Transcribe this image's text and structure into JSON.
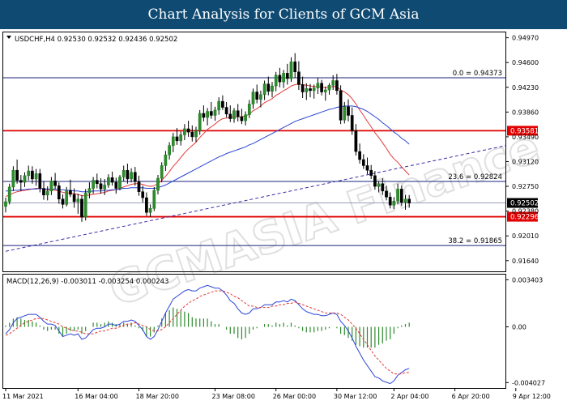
{
  "header": {
    "title": "Chart Analysis for Clients of GCM Asia"
  },
  "watermark": {
    "text": "GCMASIA Finance",
    "logo": "GCMASIA"
  },
  "chart_data": {
    "type": "candlestick",
    "symbol_info": "USDCHF,H4  0.92530 0.92532 0.92436 0.92502",
    "ylim": [
      0.9148,
      0.9505
    ],
    "y_ticks": [
      "0.94970",
      "0.94600",
      "0.94230",
      "0.93860",
      "0.93490",
      "0.93120",
      "0.92750",
      "0.92380",
      "0.92010",
      "0.91640"
    ],
    "x_ticks": [
      {
        "label": "11 Mar 2021",
        "index": 0
      },
      {
        "label": "16 Mar 04:00",
        "index": 19
      },
      {
        "label": "18 Mar 20:00",
        "index": 35
      },
      {
        "label": "23 Mar 08:00",
        "index": 55
      },
      {
        "label": "26 Mar 00:00",
        "index": 71
      },
      {
        "label": "30 Mar 12:00",
        "index": 87
      },
      {
        "label": "2 Apr 04:00",
        "index": 102
      },
      {
        "label": "6 Apr 20:00",
        "index": 118
      },
      {
        "label": "9 Apr 12:00",
        "index": 134
      }
    ],
    "levels": [
      {
        "label": "0.0 = 0.94373",
        "value": 0.94373,
        "color": "#1a237e",
        "type": "fib"
      },
      {
        "label": "0.93581",
        "value": 0.93581,
        "color": "#e00000",
        "type": "resistance"
      },
      {
        "label": "23.6 = 0.92824",
        "value": 0.92824,
        "color": "#1a237e",
        "type": "fib"
      },
      {
        "label": "0.92502",
        "value": 0.92502,
        "color": "#000000",
        "type": "current"
      },
      {
        "label": "0.92296",
        "value": 0.92296,
        "color": "#e00000",
        "type": "support"
      },
      {
        "label": "38.2 = 0.91865",
        "value": 0.91865,
        "color": "#1a237e",
        "type": "fib"
      }
    ],
    "trendline": {
      "start": [
        0,
        0.9178
      ],
      "end": [
        173,
        0.9386
      ],
      "color": "#3a2aa8",
      "style": "dashed"
    },
    "ohlc": [
      [
        0.9245,
        0.9258,
        0.9236,
        0.9252
      ],
      [
        0.9252,
        0.9279,
        0.9248,
        0.9274
      ],
      [
        0.9274,
        0.9305,
        0.9268,
        0.9299
      ],
      [
        0.9299,
        0.9315,
        0.9279,
        0.9284
      ],
      [
        0.9284,
        0.9292,
        0.9268,
        0.9281
      ],
      [
        0.9281,
        0.9296,
        0.9274,
        0.9291
      ],
      [
        0.9291,
        0.9306,
        0.9284,
        0.9298
      ],
      [
        0.9298,
        0.9305,
        0.9279,
        0.9286
      ],
      [
        0.9286,
        0.9301,
        0.9276,
        0.9294
      ],
      [
        0.9294,
        0.9301,
        0.9266,
        0.9272
      ],
      [
        0.9272,
        0.9283,
        0.9255,
        0.9262
      ],
      [
        0.9262,
        0.9275,
        0.9254,
        0.9268
      ],
      [
        0.9268,
        0.9289,
        0.9262,
        0.9283
      ],
      [
        0.9283,
        0.9295,
        0.9271,
        0.9276
      ],
      [
        0.9276,
        0.9281,
        0.9249,
        0.9256
      ],
      [
        0.9256,
        0.9263,
        0.9242,
        0.9248
      ],
      [
        0.9248,
        0.9274,
        0.9245,
        0.9269
      ],
      [
        0.9269,
        0.9285,
        0.9259,
        0.9263
      ],
      [
        0.9263,
        0.9272,
        0.9243,
        0.9252
      ],
      [
        0.9252,
        0.9264,
        0.9234,
        0.9256
      ],
      [
        0.9256,
        0.9262,
        0.9222,
        0.9229
      ],
      [
        0.9229,
        0.9271,
        0.9224,
        0.9265
      ],
      [
        0.9265,
        0.9281,
        0.9257,
        0.9272
      ],
      [
        0.9272,
        0.9289,
        0.9264,
        0.9284
      ],
      [
        0.9284,
        0.9294,
        0.9272,
        0.9279
      ],
      [
        0.9279,
        0.9287,
        0.9264,
        0.9271
      ],
      [
        0.9271,
        0.9286,
        0.9262,
        0.9277
      ],
      [
        0.9277,
        0.9293,
        0.9273,
        0.9288
      ],
      [
        0.9288,
        0.9297,
        0.9276,
        0.9281
      ],
      [
        0.9281,
        0.9288,
        0.9264,
        0.9272
      ],
      [
        0.9272,
        0.9292,
        0.9269,
        0.9289
      ],
      [
        0.9289,
        0.9306,
        0.9283,
        0.9299
      ],
      [
        0.9299,
        0.9309,
        0.9279,
        0.9286
      ],
      [
        0.9286,
        0.9302,
        0.9281,
        0.9296
      ],
      [
        0.9296,
        0.9304,
        0.9276,
        0.9282
      ],
      [
        0.9282,
        0.9291,
        0.9261,
        0.9267
      ],
      [
        0.9267,
        0.9276,
        0.9251,
        0.9258
      ],
      [
        0.9258,
        0.9266,
        0.9231,
        0.9236
      ],
      [
        0.9236,
        0.9248,
        0.9229,
        0.9242
      ],
      [
        0.9242,
        0.9274,
        0.9238,
        0.9269
      ],
      [
        0.9269,
        0.9292,
        0.9263,
        0.9287
      ],
      [
        0.9287,
        0.9311,
        0.9281,
        0.9306
      ],
      [
        0.9306,
        0.9328,
        0.9298,
        0.9322
      ],
      [
        0.9322,
        0.9341,
        0.9315,
        0.9336
      ],
      [
        0.9336,
        0.9355,
        0.9326,
        0.9349
      ],
      [
        0.9349,
        0.9362,
        0.9337,
        0.9343
      ],
      [
        0.9343,
        0.9357,
        0.9336,
        0.9352
      ],
      [
        0.9352,
        0.9368,
        0.9344,
        0.9361
      ],
      [
        0.9361,
        0.9373,
        0.9349,
        0.9356
      ],
      [
        0.9356,
        0.9366,
        0.9342,
        0.9349
      ],
      [
        0.9349,
        0.9364,
        0.9341,
        0.9358
      ],
      [
        0.9358,
        0.9389,
        0.9352,
        0.9384
      ],
      [
        0.9384,
        0.9396,
        0.9372,
        0.9378
      ],
      [
        0.9378,
        0.9392,
        0.9366,
        0.9387
      ],
      [
        0.9387,
        0.9401,
        0.9376,
        0.9381
      ],
      [
        0.9381,
        0.9394,
        0.9373,
        0.9389
      ],
      [
        0.9389,
        0.9408,
        0.9382,
        0.9402
      ],
      [
        0.9402,
        0.9411,
        0.9389,
        0.9393
      ],
      [
        0.9393,
        0.9401,
        0.9378,
        0.9383
      ],
      [
        0.9383,
        0.9396,
        0.9371,
        0.9376
      ],
      [
        0.9376,
        0.9392,
        0.937,
        0.9388
      ],
      [
        0.9388,
        0.9398,
        0.9372,
        0.9379
      ],
      [
        0.9379,
        0.9391,
        0.9368,
        0.9373
      ],
      [
        0.9373,
        0.9387,
        0.9366,
        0.9382
      ],
      [
        0.9382,
        0.9404,
        0.9377,
        0.9398
      ],
      [
        0.9398,
        0.9421,
        0.9391,
        0.9416
      ],
      [
        0.9416,
        0.9427,
        0.9399,
        0.9405
      ],
      [
        0.9405,
        0.9418,
        0.9393,
        0.9412
      ],
      [
        0.9412,
        0.9433,
        0.9404,
        0.9428
      ],
      [
        0.9428,
        0.9439,
        0.9411,
        0.9417
      ],
      [
        0.9417,
        0.9431,
        0.9408,
        0.9425
      ],
      [
        0.9425,
        0.9446,
        0.9417,
        0.9441
      ],
      [
        0.9441,
        0.9452,
        0.9423,
        0.9431
      ],
      [
        0.9431,
        0.9449,
        0.9422,
        0.9444
      ],
      [
        0.9444,
        0.9458,
        0.9427,
        0.9436
      ],
      [
        0.9436,
        0.9468,
        0.9431,
        0.9461
      ],
      [
        0.9461,
        0.9474,
        0.9437,
        0.9446
      ],
      [
        0.9446,
        0.9462,
        0.9419,
        0.9427
      ],
      [
        0.9427,
        0.9439,
        0.9407,
        0.9416
      ],
      [
        0.9416,
        0.9429,
        0.9404,
        0.9421
      ],
      [
        0.9421,
        0.9428,
        0.9408,
        0.9418
      ],
      [
        0.9418,
        0.9427,
        0.9406,
        0.9422
      ],
      [
        0.9422,
        0.9437,
        0.9413,
        0.9429
      ],
      [
        0.9429,
        0.9434,
        0.9411,
        0.9416
      ],
      [
        0.9416,
        0.9424,
        0.9403,
        0.9419
      ],
      [
        0.9419,
        0.9429,
        0.9412,
        0.9426
      ],
      [
        0.9426,
        0.9441,
        0.9419,
        0.9433
      ],
      [
        0.9433,
        0.9443,
        0.9412,
        0.9418
      ],
      [
        0.9418,
        0.9426,
        0.9368,
        0.9374
      ],
      [
        0.9374,
        0.9401,
        0.9369,
        0.9394
      ],
      [
        0.9394,
        0.9405,
        0.9372,
        0.9381
      ],
      [
        0.9381,
        0.9393,
        0.9352,
        0.9358
      ],
      [
        0.9358,
        0.9368,
        0.9321,
        0.9327
      ],
      [
        0.9327,
        0.9339,
        0.9309,
        0.9315
      ],
      [
        0.9315,
        0.9323,
        0.9301,
        0.9306
      ],
      [
        0.9306,
        0.9318,
        0.9293,
        0.9299
      ],
      [
        0.9299,
        0.9307,
        0.9286,
        0.9291
      ],
      [
        0.9291,
        0.9298,
        0.927,
        0.9275
      ],
      [
        0.9275,
        0.9283,
        0.9266,
        0.9279
      ],
      [
        0.9279,
        0.9287,
        0.9262,
        0.9268
      ],
      [
        0.9268,
        0.9276,
        0.9254,
        0.9259
      ],
      [
        0.9259,
        0.9266,
        0.9242,
        0.9247
      ],
      [
        0.9247,
        0.9259,
        0.9241,
        0.9253
      ],
      [
        0.9253,
        0.9279,
        0.9248,
        0.9271
      ],
      [
        0.9271,
        0.9276,
        0.9246,
        0.9251
      ],
      [
        0.9251,
        0.9262,
        0.924,
        0.9256
      ],
      [
        0.9256,
        0.9262,
        0.9243,
        0.925
      ]
    ],
    "ma_red": [
      0.926,
      0.9262,
      0.9265,
      0.9267,
      0.9268,
      0.9269,
      0.927,
      0.9271,
      0.9272,
      0.9272,
      0.9271,
      0.927,
      0.927,
      0.9269,
      0.9268,
      0.9266,
      0.9265,
      0.9265,
      0.9264,
      0.9263,
      0.9261,
      0.9261,
      0.9262,
      0.9263,
      0.9264,
      0.9265,
      0.9266,
      0.9268,
      0.9269,
      0.927,
      0.9272,
      0.9274,
      0.9276,
      0.9278,
      0.9279,
      0.9279,
      0.9278,
      0.9276,
      0.9275,
      0.9276,
      0.9279,
      0.9284,
      0.929,
      0.9297,
      0.9305,
      0.9311,
      0.9318,
      0.9325,
      0.9331,
      0.9336,
      0.9341,
      0.9348,
      0.9354,
      0.936,
      0.9364,
      0.9368,
      0.9373,
      0.9376,
      0.9377,
      0.9378,
      0.9379,
      0.9379,
      0.9379,
      0.938,
      0.9383,
      0.9388,
      0.9391,
      0.9395,
      0.94,
      0.9403,
      0.9406,
      0.9411,
      0.9414,
      0.9418,
      0.9421,
      0.9425,
      0.9427,
      0.9428,
      0.9427,
      0.9426,
      0.9425,
      0.9424,
      0.9424,
      0.9423,
      0.9423,
      0.9423,
      0.9424,
      0.9424,
      0.9419,
      0.9416,
      0.9412,
      0.9406,
      0.9398,
      0.9389,
      0.9381,
      0.9372,
      0.9364,
      0.9355,
      0.9348,
      0.934,
      0.9332,
      0.9323,
      0.9316,
      0.9311,
      0.9304,
      0.9298,
      0.9292
    ],
    "ma_blue": [
      0.9268,
      0.9268,
      0.9269,
      0.9269,
      0.927,
      0.927,
      0.9271,
      0.9271,
      0.9271,
      0.9272,
      0.9271,
      0.9271,
      0.9271,
      0.9271,
      0.927,
      0.927,
      0.9269,
      0.9269,
      0.9268,
      0.9268,
      0.9267,
      0.9267,
      0.9267,
      0.9268,
      0.9268,
      0.9268,
      0.9269,
      0.9269,
      0.927,
      0.927,
      0.9271,
      0.9272,
      0.9272,
      0.9273,
      0.9273,
      0.9273,
      0.9273,
      0.9272,
      0.9272,
      0.9272,
      0.9273,
      0.9275,
      0.9277,
      0.928,
      0.9283,
      0.9286,
      0.9289,
      0.9292,
      0.9295,
      0.9298,
      0.9301,
      0.9304,
      0.9307,
      0.931,
      0.9313,
      0.9316,
      0.9319,
      0.9321,
      0.9324,
      0.9326,
      0.9328,
      0.933,
      0.9332,
      0.9334,
      0.9337,
      0.9339,
      0.9342,
      0.9345,
      0.9348,
      0.9351,
      0.9354,
      0.9357,
      0.936,
      0.9363,
      0.9366,
      0.9369,
      0.9372,
      0.9374,
      0.9376,
      0.9378,
      0.938,
      0.9382,
      0.9384,
      0.9386,
      0.9388,
      0.939,
      0.9391,
      0.9393,
      0.9394,
      0.9395,
      0.9395,
      0.9395,
      0.9394,
      0.9392,
      0.939,
      0.9387,
      0.9383,
      0.9379,
      0.9375,
      0.937,
      0.9366,
      0.9361,
      0.9356,
      0.9352,
      0.9347,
      0.9343,
      0.9338
    ],
    "macd": {
      "label": "MACD(12,26,9) -0.003011 -0.003254 0.000243",
      "ylim": [
        -0.0043,
        0.0036
      ],
      "y_ticks": [
        "0.003403",
        "0.00",
        "-0.004027"
      ],
      "values": [
        -0.0005,
        -0.0002,
        0.0003,
        0.0006,
        0.0007,
        0.0008,
        0.0009,
        0.0009,
        0.0009,
        0.0007,
        0.0004,
        0.0002,
        0.0002,
        0.0001,
        -0.0003,
        -0.0007,
        -0.0006,
        -0.0005,
        -0.0006,
        -0.0005,
        -0.0009,
        -0.0008,
        -0.0005,
        -0.0002,
        -0.0001,
        -0.0001,
        0.0,
        0.0002,
        0.0002,
        0.0001,
        0.0002,
        0.0004,
        0.0004,
        0.0005,
        0.0004,
        0.0001,
        -0.0002,
        -0.0007,
        -0.0009,
        -0.0007,
        -0.0002,
        0.0004,
        0.001,
        0.0015,
        0.002,
        0.0022,
        0.0024,
        0.0026,
        0.0027,
        0.0026,
        0.0026,
        0.0028,
        0.0029,
        0.003,
        0.0029,
        0.0028,
        0.0028,
        0.0026,
        0.0023,
        0.0019,
        0.0017,
        0.0013,
        0.001,
        0.0009,
        0.001,
        0.0013,
        0.0013,
        0.0014,
        0.0016,
        0.0016,
        0.0016,
        0.0018,
        0.0018,
        0.0019,
        0.0018,
        0.002,
        0.0019,
        0.0016,
        0.0013,
        0.0011,
        0.001,
        0.0009,
        0.0009,
        0.0008,
        0.0008,
        0.0009,
        0.001,
        0.0009,
        0.0004,
        0.0001,
        -0.0003,
        -0.0008,
        -0.0014,
        -0.0019,
        -0.0024,
        -0.0028,
        -0.0032,
        -0.0036,
        -0.0037,
        -0.0039,
        -0.004,
        -0.0041,
        -0.0039,
        -0.0035,
        -0.0033,
        -0.0031,
        -0.003
      ],
      "signal": [
        -0.0006,
        -0.0005,
        -0.0003,
        -0.0001,
        0.0001,
        0.0003,
        0.0004,
        0.0005,
        0.0006,
        0.0006,
        0.0006,
        0.0005,
        0.0004,
        0.0003,
        0.0002,
        0.0,
        -0.0001,
        -0.0002,
        -0.0003,
        -0.0003,
        -0.0004,
        -0.0005,
        -0.0005,
        -0.0005,
        -0.0004,
        -0.0003,
        -0.0003,
        -0.0002,
        -0.0001,
        -0.0001,
        0.0,
        0.0001,
        0.0002,
        0.0002,
        0.0003,
        0.0002,
        0.0001,
        0.0,
        -0.0002,
        -0.0003,
        -0.0003,
        -0.0002,
        0.0,
        0.0003,
        0.0006,
        0.0009,
        0.0012,
        0.0015,
        0.0017,
        0.0019,
        0.002,
        0.0022,
        0.0023,
        0.0024,
        0.0025,
        0.0026,
        0.0026,
        0.0026,
        0.0025,
        0.0024,
        0.0022,
        0.0021,
        0.0019,
        0.0017,
        0.0015,
        0.0015,
        0.0014,
        0.0014,
        0.0014,
        0.0014,
        0.0015,
        0.0015,
        0.0016,
        0.0016,
        0.0017,
        0.0017,
        0.0018,
        0.0017,
        0.0016,
        0.0015,
        0.0014,
        0.0013,
        0.0012,
        0.0011,
        0.001,
        0.001,
        0.001,
        0.001,
        0.0009,
        0.0007,
        0.0005,
        0.0002,
        -0.0001,
        -0.0005,
        -0.0009,
        -0.0013,
        -0.0017,
        -0.0021,
        -0.0024,
        -0.0027,
        -0.003,
        -0.0032,
        -0.0034,
        -0.0034,
        -0.0034,
        -0.0033,
        -0.0033
      ]
    }
  }
}
